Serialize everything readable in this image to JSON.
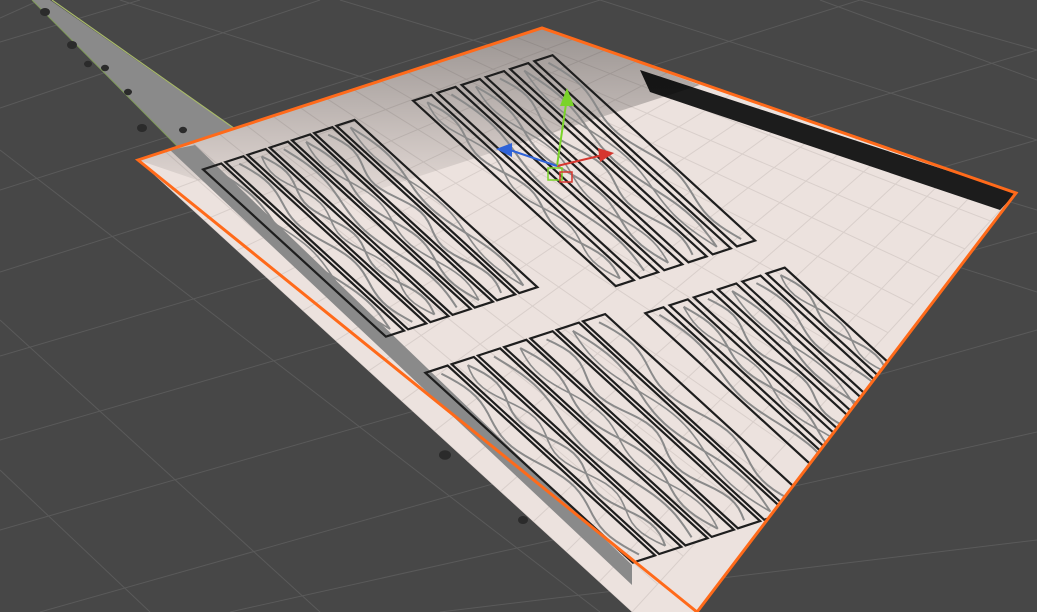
{
  "viewport": {
    "background": "#474747",
    "grid_color": "#5a5a5a"
  },
  "scene": {
    "plane": {
      "selected": true,
      "outline_color": "#ff6a1a",
      "paper_color": "#ede3df",
      "pencil_color": "#8a8a8a",
      "ink_color": "#1e1e1e"
    },
    "side_plane": {
      "color": "#8c8c8c",
      "edge_color": "#9ab05a"
    }
  },
  "gizmo": {
    "axes": [
      {
        "axis": "x",
        "color": "#d6362e"
      },
      {
        "axis": "y",
        "color": "#7ad32a"
      },
      {
        "axis": "z",
        "color": "#2f63d8"
      }
    ]
  }
}
